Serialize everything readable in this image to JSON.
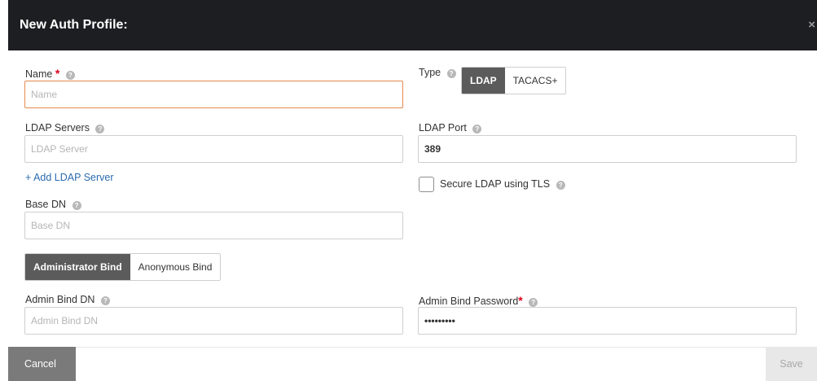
{
  "dialog": {
    "title": "New Auth Profile:",
    "close_symbol": "×"
  },
  "fields": {
    "name": {
      "label": "Name",
      "required_mark": "*",
      "placeholder": "Name",
      "value": ""
    },
    "type": {
      "label": "Type",
      "options": [
        "LDAP",
        "TACACS+"
      ],
      "selected": "LDAP"
    },
    "ldap_servers": {
      "label": "LDAP Servers",
      "placeholder": "LDAP Server",
      "value": ""
    },
    "ldap_port": {
      "label": "LDAP Port",
      "placeholder": "",
      "value": "389"
    },
    "add_ldap_server": {
      "label": "+ Add LDAP Server"
    },
    "secure_ldap": {
      "label": "Secure LDAP using TLS",
      "checked": false
    },
    "base_dn": {
      "label": "Base DN",
      "placeholder": "Base DN",
      "value": ""
    },
    "bind_mode": {
      "options": [
        "Administrator Bind",
        "Anonymous Bind"
      ],
      "selected": "Administrator Bind"
    },
    "admin_bind_dn": {
      "label": "Admin Bind DN",
      "placeholder": "Admin Bind DN",
      "value": ""
    },
    "admin_bind_password": {
      "label": "Admin Bind Password",
      "required_mark": "*",
      "value": "•••••••••"
    }
  },
  "help_glyph": "?",
  "footer": {
    "cancel_label": "Cancel",
    "save_label": "Save"
  },
  "colors": {
    "header_bg": "#1d1e22",
    "active_segment": "#5b5b5b",
    "focus_border": "#e58a4e",
    "required": "#e0001b",
    "link": "#2b6bb0"
  }
}
